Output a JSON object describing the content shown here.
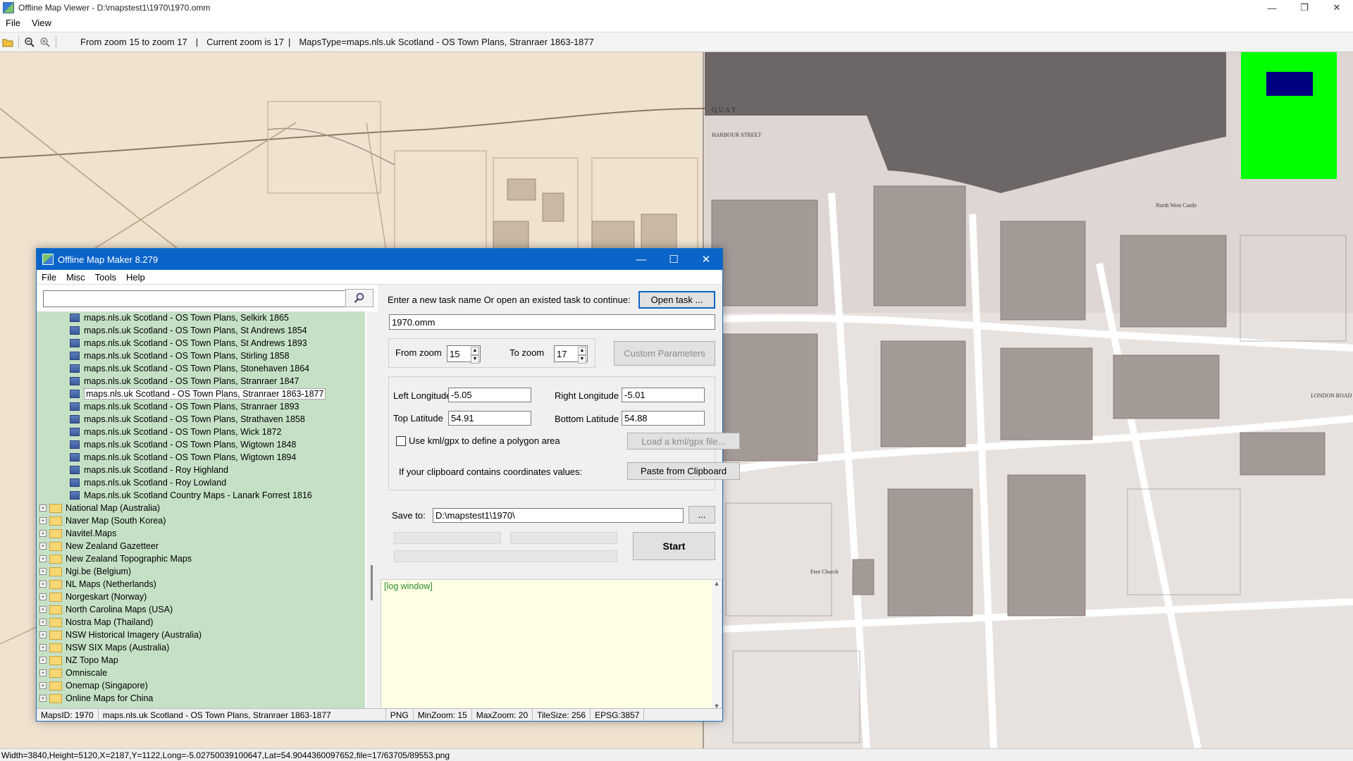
{
  "window": {
    "title": "Offline Map Viewer - D:\\mapstest1\\1970\\1970.omm",
    "controls": {
      "minimize": "—",
      "restore": "❐",
      "close": "✕"
    }
  },
  "menu": [
    "File",
    "View"
  ],
  "toolbar": {
    "zoom_range": "From zoom 15 to zoom 17",
    "current_zoom": "Current zoom is 17",
    "maps_type": "MapsType=maps.nls.uk Scotland - OS Town Plans, Stranraer 1863-1877",
    "separator": "|"
  },
  "status_text": "Width=3840,Height=5120,X=2187,Y=1122,Long=-5.02750039100647,Lat=54.9044360097652,file=17/63705/89553.png",
  "map_labels": {
    "quay": "Q U A Y",
    "harbour_street": "HARBOUR STREET",
    "london_road": "LONDON ROAD",
    "free_church": "Free Church",
    "north_west_castle": "North West Castle"
  },
  "dialog": {
    "title": "Offline Map Maker 8.279",
    "controls": {
      "minimize": "—",
      "maximize": "☐",
      "close": "✕"
    },
    "menu": [
      "File",
      "Misc",
      "Tools",
      "Help"
    ],
    "search": {
      "placeholder": "",
      "icon": "search-icon"
    },
    "tree_children": [
      "maps.nls.uk Scotland - OS Town Plans, Selkirk 1865",
      "maps.nls.uk Scotland - OS Town Plans, St Andrews 1854",
      "maps.nls.uk Scotland - OS Town Plans, St Andrews 1893",
      "maps.nls.uk Scotland - OS Town Plans, Stirling 1858",
      "maps.nls.uk Scotland - OS Town Plans, Stonehaven 1864",
      "maps.nls.uk Scotland - OS Town Plans, Stranraer 1847",
      "maps.nls.uk Scotland - OS Town Plans, Stranraer 1863-1877",
      "maps.nls.uk Scotland - OS Town Plans, Stranraer 1893",
      "maps.nls.uk Scotland - OS Town Plans, Strathaven 1858",
      "maps.nls.uk Scotland - OS Town Plans, Wick 1872",
      "maps.nls.uk Scotland - OS Town Plans, Wigtown 1848",
      "maps.nls.uk Scotland - OS Town Plans, Wigtown 1894",
      "maps.nls.uk Scotland - Roy Highland",
      "maps.nls.uk Scotland - Roy Lowland",
      "Maps.nls.uk Scotland Country Maps - Lanark Forrest 1816"
    ],
    "selected_child_index": 6,
    "tree_groups": [
      "National Map (Australia)",
      "Naver Map (South Korea)",
      "Navitel.Maps",
      "New Zealand Gazetteer",
      "New Zealand Topographic Maps",
      "Ngi.be (Belgium)",
      "NL Maps (Netherlands)",
      "Norgeskart (Norway)",
      "North Carolina Maps (USA)",
      "Nostra Map (Thailand)",
      "NSW Historical Imagery (Australia)",
      "NSW SIX Maps (Australia)",
      "NZ Topo Map",
      "Omniscale",
      "Onemap (Singapore)",
      "Online Maps for China"
    ],
    "task_prompt": "Enter a new task name Or open an existed task to continue:",
    "open_task_label": "Open task ...",
    "task_name": "1970.omm",
    "from_zoom_label": "From zoom",
    "from_zoom": "15",
    "to_zoom_label": "To zoom",
    "to_zoom": "17",
    "custom_params_label": "Custom Parameters",
    "left_lon_label": "Left Longitude",
    "left_lon": "-5.05",
    "right_lon_label": "Right Longitude",
    "right_lon": "-5.01",
    "top_lat_label": "Top Latitude",
    "top_lat": "54.91",
    "bottom_lat_label": "Bottom Latitude",
    "bottom_lat": "54.88",
    "kml_check_label": "Use kml/gpx to define a polygon area",
    "load_kml_label": "Load a kml/gpx file...",
    "clipboard_text": "If your clipboard contains coordinates values:",
    "paste_label": "Paste from Clipboard",
    "save_to_label": "Save to:",
    "save_to": "D:\\mapstest1\\1970\\",
    "browse_label": "...",
    "start_label": "Start",
    "log_text": "[log window]",
    "status": {
      "maps_id": "MapsID: 1970",
      "map_name": "maps.nls.uk Scotland - OS Town Plans, Stranraer 1863-1877",
      "format": "PNG",
      "min_zoom": "MinZoom: 15",
      "max_zoom": "MaxZoom: 20",
      "tile_size": "TileSize: 256",
      "epsg": "EPSG:3857"
    }
  },
  "colors": {
    "accent": "#0a64c8",
    "tree_bg": "#c6e0c6",
    "minimap_bg": "#00ff00",
    "minimap_view": "#000080",
    "log_text": "#2e8b2e"
  }
}
